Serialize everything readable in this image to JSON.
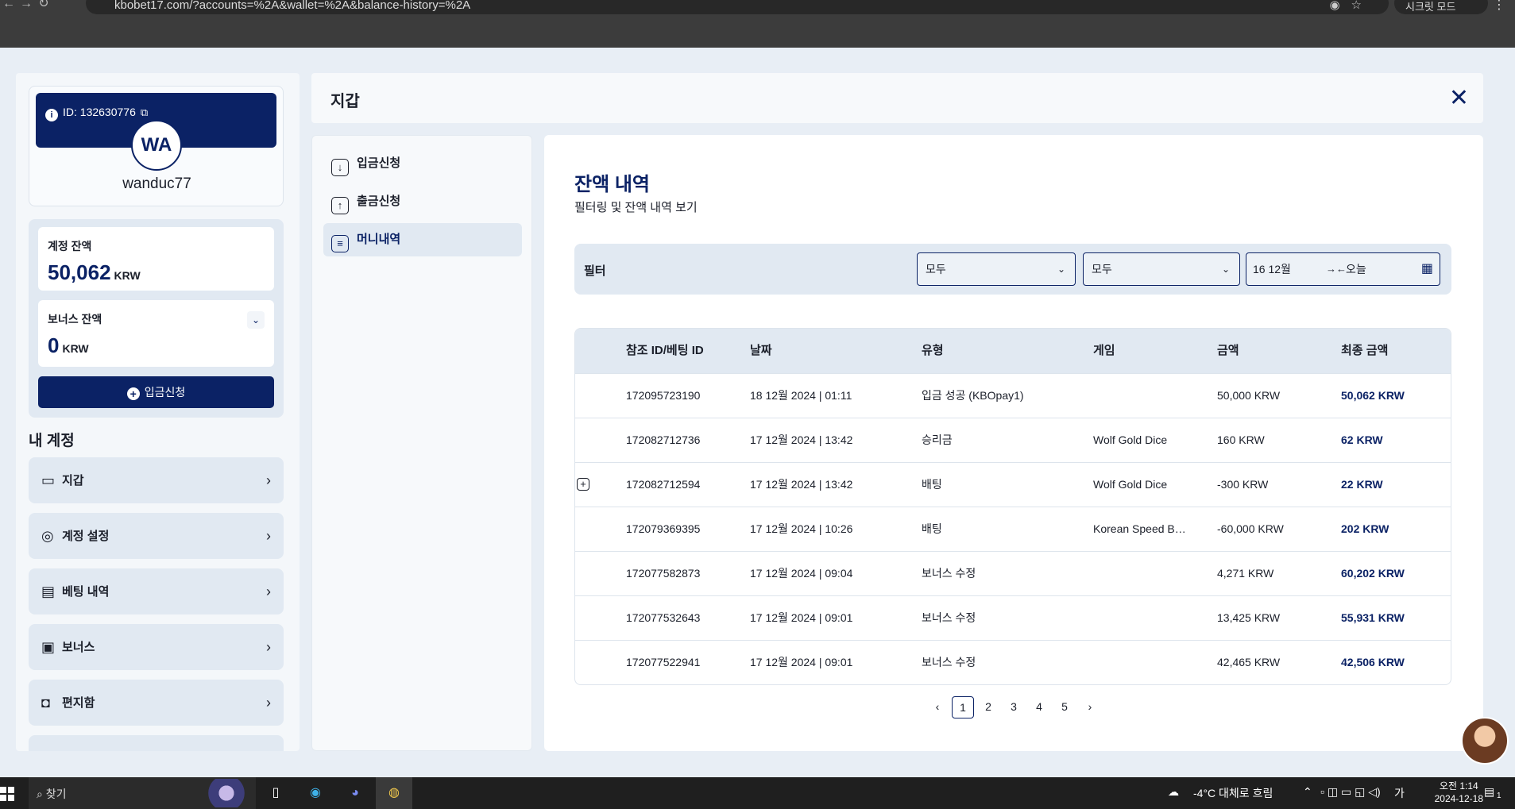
{
  "browser": {
    "url": "kbobet17.com/?accounts=%2A&wallet=%2A&balance-history=%2A",
    "profile_label": "시크릿 모드"
  },
  "sidebar": {
    "user_id": "ID: 132630776",
    "avatar_initials": "WA",
    "username": "wanduc77",
    "account_balance_label": "계정 잔액",
    "account_balance_value": "50,062",
    "currency": "KRW",
    "bonus_balance_label": "보너스 잔액",
    "bonus_balance_value": "0",
    "deposit_button": "입금신청",
    "section_title": "내 계정",
    "items": [
      {
        "label": "지갑",
        "icon": "wallet-icon"
      },
      {
        "label": "계정 설정",
        "icon": "user-settings-icon"
      },
      {
        "label": "베팅 내역",
        "icon": "receipt-icon"
      },
      {
        "label": "보너스",
        "icon": "gift-icon"
      },
      {
        "label": "편지함",
        "icon": "chat-icon"
      }
    ]
  },
  "header": {
    "title": "지갑"
  },
  "wallet_nav": [
    {
      "label": "입금신청",
      "icon": "download-icon"
    },
    {
      "label": "출금신청",
      "icon": "upload-icon"
    },
    {
      "label": "머니내역",
      "icon": "document-icon",
      "active": true
    }
  ],
  "main": {
    "title": "잔액 내역",
    "subtitle": "필터링 및 잔액 내역 보기",
    "filter": {
      "label": "필터",
      "select1": "모두",
      "select2": "모두",
      "date_from": "16 12월",
      "date_to": "오늘"
    },
    "table": {
      "headers": [
        "참조 ID/베팅 ID",
        "날짜",
        "유형",
        "게임",
        "금액",
        "최종 금액"
      ],
      "rows": [
        {
          "id": "172095723190",
          "date": "18 12월 2024 | 01:11",
          "type": "입금 성공 (KBOpay1)",
          "game": "",
          "amount": "50,000 KRW",
          "final": "50,062 KRW"
        },
        {
          "id": "172082712736",
          "date": "17 12월 2024 | 13:42",
          "type": "승리금",
          "game": "Wolf Gold Dice",
          "amount": "160 KRW",
          "final": "62 KRW"
        },
        {
          "id": "172082712594",
          "date": "17 12월 2024 | 13:42",
          "type": "배팅",
          "game": "Wolf Gold Dice",
          "amount": "-300 KRW",
          "final": "22 KRW",
          "expandable": true
        },
        {
          "id": "172079369395",
          "date": "17 12월 2024 | 10:26",
          "type": "배팅",
          "game": "Korean Speed B…",
          "amount": "-60,000 KRW",
          "final": "202 KRW"
        },
        {
          "id": "172077582873",
          "date": "17 12월 2024 | 09:04",
          "type": "보너스 수정",
          "game": "",
          "amount": "4,271 KRW",
          "final": "60,202 KRW"
        },
        {
          "id": "172077532643",
          "date": "17 12월 2024 | 09:01",
          "type": "보너스 수정",
          "game": "",
          "amount": "13,425 KRW",
          "final": "55,931 KRW"
        },
        {
          "id": "172077522941",
          "date": "17 12월 2024 | 09:01",
          "type": "보너스 수정",
          "game": "",
          "amount": "42,465 KRW",
          "final": "42,506 KRW"
        }
      ]
    },
    "pagination": {
      "pages": [
        "1",
        "2",
        "3",
        "4",
        "5"
      ],
      "current": "1",
      "prev": "‹",
      "next": "›"
    }
  },
  "taskbar": {
    "search_placeholder": "찾기",
    "weather": "-4°C  대체로 흐림",
    "ime": "가",
    "time": "오전 1:14",
    "date": "2024-12-18",
    "notification_count": "1"
  },
  "colors": {
    "brand": "#0b2265",
    "panel": "#e1e9f2",
    "background": "#e8eef5"
  }
}
